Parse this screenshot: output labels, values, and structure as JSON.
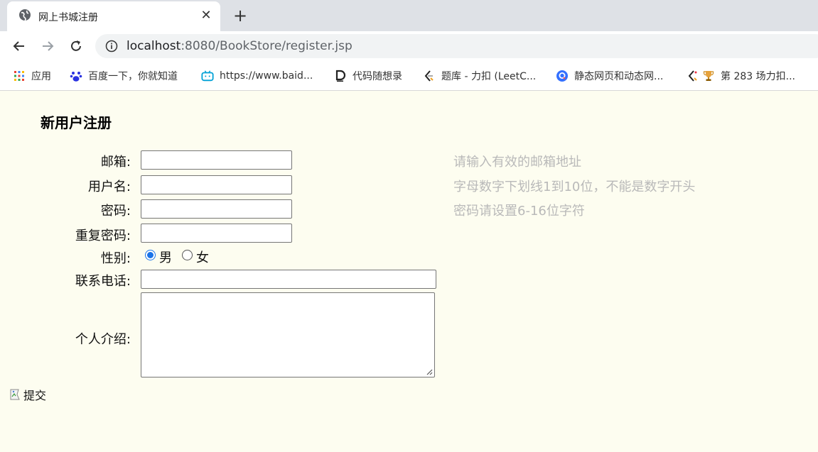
{
  "browser": {
    "tab_title": "网上书城注册",
    "url_host": "localhost",
    "url_rest": ":8080/BookStore/register.jsp",
    "bookmarks": [
      {
        "label": "应用",
        "icon": "apps-grid-icon"
      },
      {
        "label": "百度一下，你就知道",
        "icon": "baidu-paw-icon"
      },
      {
        "label": "https://www.baid...",
        "icon": "bilibili-tv-icon"
      },
      {
        "label": "代码随想录",
        "icon": "d-logo-icon"
      },
      {
        "label": "题库 - 力扣 (LeetC...",
        "icon": "leetcode-icon"
      },
      {
        "label": "静态网页和动态网...",
        "icon": "search-q-icon"
      },
      {
        "label": "第 283 场力扣...",
        "icon": "trophy-icon"
      }
    ]
  },
  "form": {
    "title": "新用户注册",
    "email_label": "邮箱:",
    "username_label": "用户名:",
    "password_label": "密码:",
    "repeat_password_label": "重复密码:",
    "gender_label": "性别:",
    "gender_male": "男",
    "gender_female": "女",
    "gender_selected": "男",
    "phone_label": "联系电话:",
    "intro_label": "个人介绍:",
    "submit_label": "提交",
    "hints": {
      "email": "请输入有效的邮箱地址",
      "username": "字母数字下划线1到10位，不能是数字开头",
      "password": "密码请设置6-16位字符"
    }
  },
  "colors": {
    "page_background": "#fdfdf0",
    "hint_text": "#b9b9b9",
    "radio_accent": "#1a73e8"
  }
}
